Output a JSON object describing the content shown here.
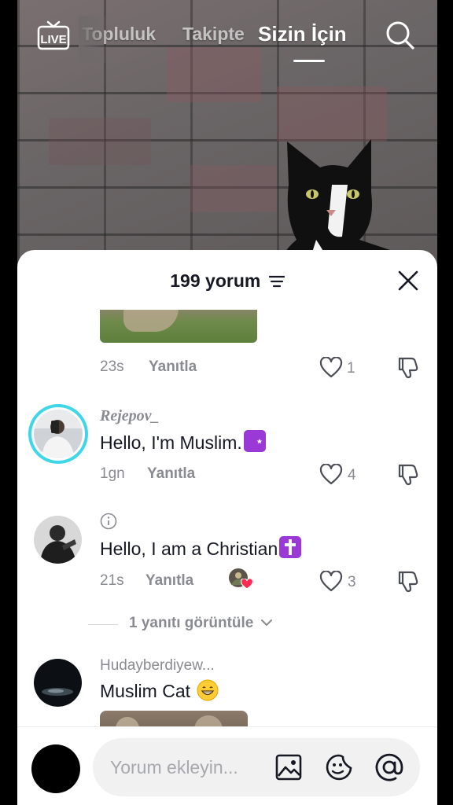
{
  "top_tabs": [
    "Topluluk",
    "Takipte",
    "Sizin İçin"
  ],
  "active_tab": "Sizin İçin",
  "live_label": "LIVE",
  "comments_count_label": "199 yorum",
  "comments": [
    {
      "username": "",
      "text": "",
      "time": "23s",
      "reply_label": "Yanıtla",
      "likes": "1"
    },
    {
      "username": "Rejepov_",
      "text": "Hello, I'm Muslim.",
      "time": "1gn",
      "reply_label": "Yanıtla",
      "likes": "4",
      "emoji": "star-and-crescent"
    },
    {
      "username": "",
      "text": "Hello, I am a Christian",
      "time": "21s",
      "reply_label": "Yanıtla",
      "likes": "3",
      "emoji": "latin-cross",
      "view_replies_label": "1 yanıtı görüntüle"
    },
    {
      "username": "Hudayberdiyew...",
      "text": "Muslim Cat",
      "emoji": "grinning-face"
    }
  ],
  "input": {
    "placeholder": "Yorum ekleyin..."
  },
  "colors": {
    "accent_cyan": "#3fd6e8",
    "heart_red": "#fe2c55",
    "emoji_purple": "#9b39d6",
    "text_primary": "#161823",
    "text_secondary": "#8a8b91"
  }
}
